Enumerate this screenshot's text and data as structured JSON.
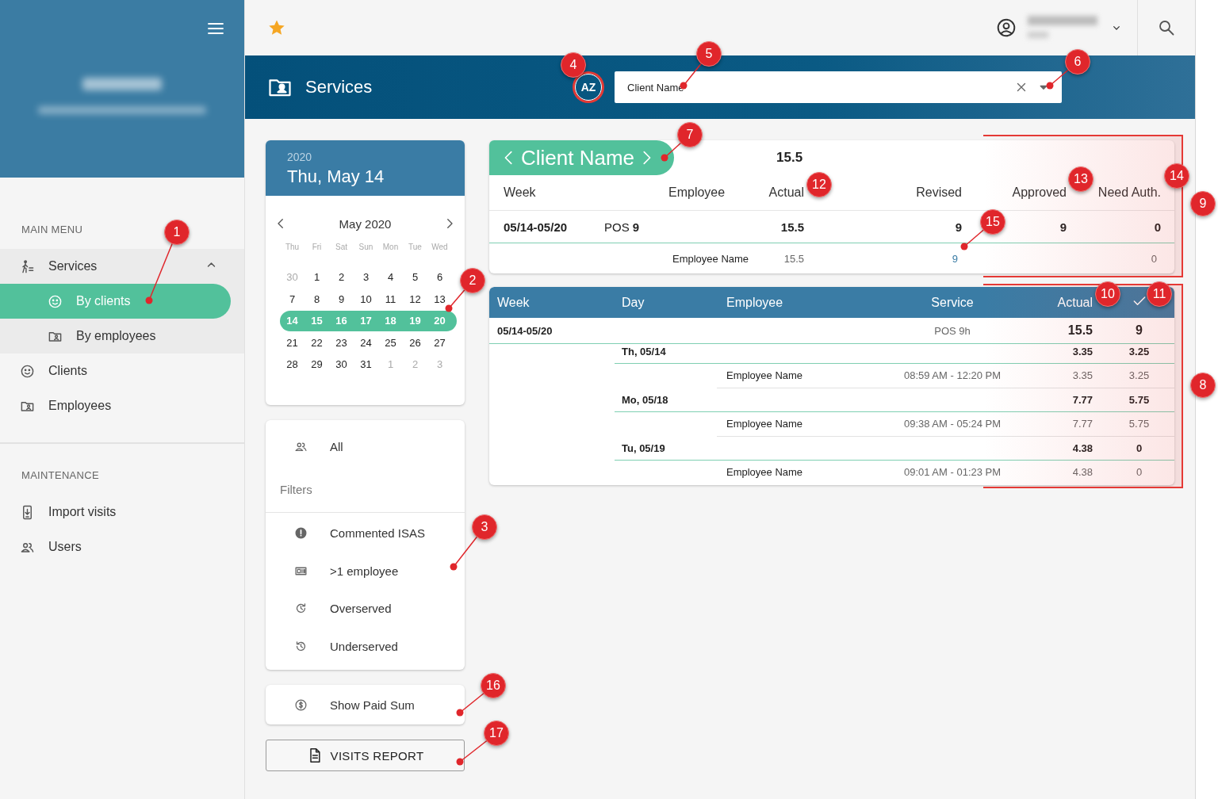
{
  "sidebar": {
    "sections": [
      {
        "title": "MAIN MENU",
        "items": [
          {
            "label": "Services",
            "expanded": true,
            "selected": false,
            "children": [
              {
                "label": "By clients",
                "selected": true
              },
              {
                "label": "By employees",
                "selected": false
              }
            ]
          },
          {
            "label": "Clients",
            "selected": false
          },
          {
            "label": "Employees",
            "selected": false
          }
        ]
      },
      {
        "title": "MAINTENANCE",
        "items": [
          {
            "label": "Import visits",
            "selected": false
          },
          {
            "label": "Users",
            "selected": false
          }
        ]
      }
    ]
  },
  "header": {
    "title": "Services",
    "sort_button": "AZ",
    "search": {
      "value": "Client Name"
    }
  },
  "calendar": {
    "year": "2020",
    "date": "Thu, May 14",
    "month": "May 2020",
    "weekdays": [
      "Thu",
      "Fri",
      "Sat",
      "Sun",
      "Mon",
      "Tue",
      "Wed"
    ],
    "weeks": [
      {
        "selected": false,
        "days": [
          {
            "label": "30",
            "outside": true
          },
          {
            "label": "1",
            "outside": false
          },
          {
            "label": "2",
            "outside": false
          },
          {
            "label": "3",
            "outside": false
          },
          {
            "label": "4",
            "outside": false
          },
          {
            "label": "5",
            "outside": false
          },
          {
            "label": "6",
            "outside": false
          }
        ]
      },
      {
        "selected": false,
        "days": [
          {
            "label": "7",
            "outside": false
          },
          {
            "label": "8",
            "outside": false
          },
          {
            "label": "9",
            "outside": false
          },
          {
            "label": "10",
            "outside": false
          },
          {
            "label": "11",
            "outside": false
          },
          {
            "label": "12",
            "outside": false
          },
          {
            "label": "13",
            "outside": false
          }
        ]
      },
      {
        "selected": true,
        "days": [
          {
            "label": "14",
            "outside": false
          },
          {
            "label": "15",
            "outside": false
          },
          {
            "label": "16",
            "outside": false
          },
          {
            "label": "17",
            "outside": false
          },
          {
            "label": "18",
            "outside": false
          },
          {
            "label": "19",
            "outside": false
          },
          {
            "label": "20",
            "outside": false
          }
        ]
      },
      {
        "selected": false,
        "days": [
          {
            "label": "21",
            "outside": false
          },
          {
            "label": "22",
            "outside": false
          },
          {
            "label": "23",
            "outside": false
          },
          {
            "label": "24",
            "outside": false
          },
          {
            "label": "25",
            "outside": false
          },
          {
            "label": "26",
            "outside": false
          },
          {
            "label": "27",
            "outside": false
          }
        ]
      },
      {
        "selected": false,
        "days": [
          {
            "label": "28",
            "outside": false
          },
          {
            "label": "29",
            "outside": false
          },
          {
            "label": "30",
            "outside": false
          },
          {
            "label": "31",
            "outside": false
          },
          {
            "label": "1",
            "outside": true
          },
          {
            "label": "2",
            "outside": true
          },
          {
            "label": "3",
            "outside": true
          }
        ]
      }
    ]
  },
  "filters": {
    "all": "All",
    "title": "Filters",
    "items": [
      "Commented ISAS",
      ">1 employee",
      "Overserved",
      "Underserved"
    ]
  },
  "paid_sum": "Show Paid Sum",
  "report_button": "VISITS REPORT",
  "summary": {
    "client_name": "Client Name",
    "total": "15.5",
    "columns": [
      "Week",
      "Employee",
      "Actual",
      "Revised",
      "Approved",
      "Need Auth."
    ],
    "row": {
      "week": "05/14-05/20",
      "pos": "POS **9**",
      "actual": "15.5",
      "revised": "9",
      "approved": "9",
      "need_auth": "0"
    },
    "subrow": {
      "employee": "Employee Name",
      "actual": "15.5",
      "revised": "9",
      "need_auth": "0"
    }
  },
  "details": {
    "columns": [
      "Week",
      "Day",
      "Employee",
      "Service",
      "Actual"
    ],
    "rows": [
      {
        "kind": "week",
        "week": "05/14-05/20",
        "service": "POS 9h",
        "actual": "15.5",
        "approved": "9"
      },
      {
        "kind": "day",
        "day": "Th, 05/14",
        "actual": "3.35",
        "approved": "3.25"
      },
      {
        "kind": "employee",
        "employee": "Employee Name",
        "service": "08:59 AM - 12:20 PM",
        "actual": "3.35",
        "approved": "3.25"
      },
      {
        "kind": "day",
        "day": "Mo, 05/18",
        "actual": "7.77",
        "approved": "5.75"
      },
      {
        "kind": "employee",
        "employee": "Employee Name",
        "service": "09:38 AM - 05:24 PM",
        "actual": "7.77",
        "approved": "5.75"
      },
      {
        "kind": "day",
        "day": "Tu, 05/19",
        "actual": "4.38",
        "approved": "0"
      },
      {
        "kind": "employee",
        "employee": "Employee Name",
        "service": "09:01 AM - 01:23 PM",
        "actual": "4.38",
        "approved": "0"
      }
    ]
  },
  "callouts": [
    "1",
    "2",
    "3",
    "4",
    "5",
    "6",
    "7",
    "8",
    "9",
    "10",
    "11",
    "12",
    "13",
    "14",
    "15",
    "16",
    "17"
  ]
}
